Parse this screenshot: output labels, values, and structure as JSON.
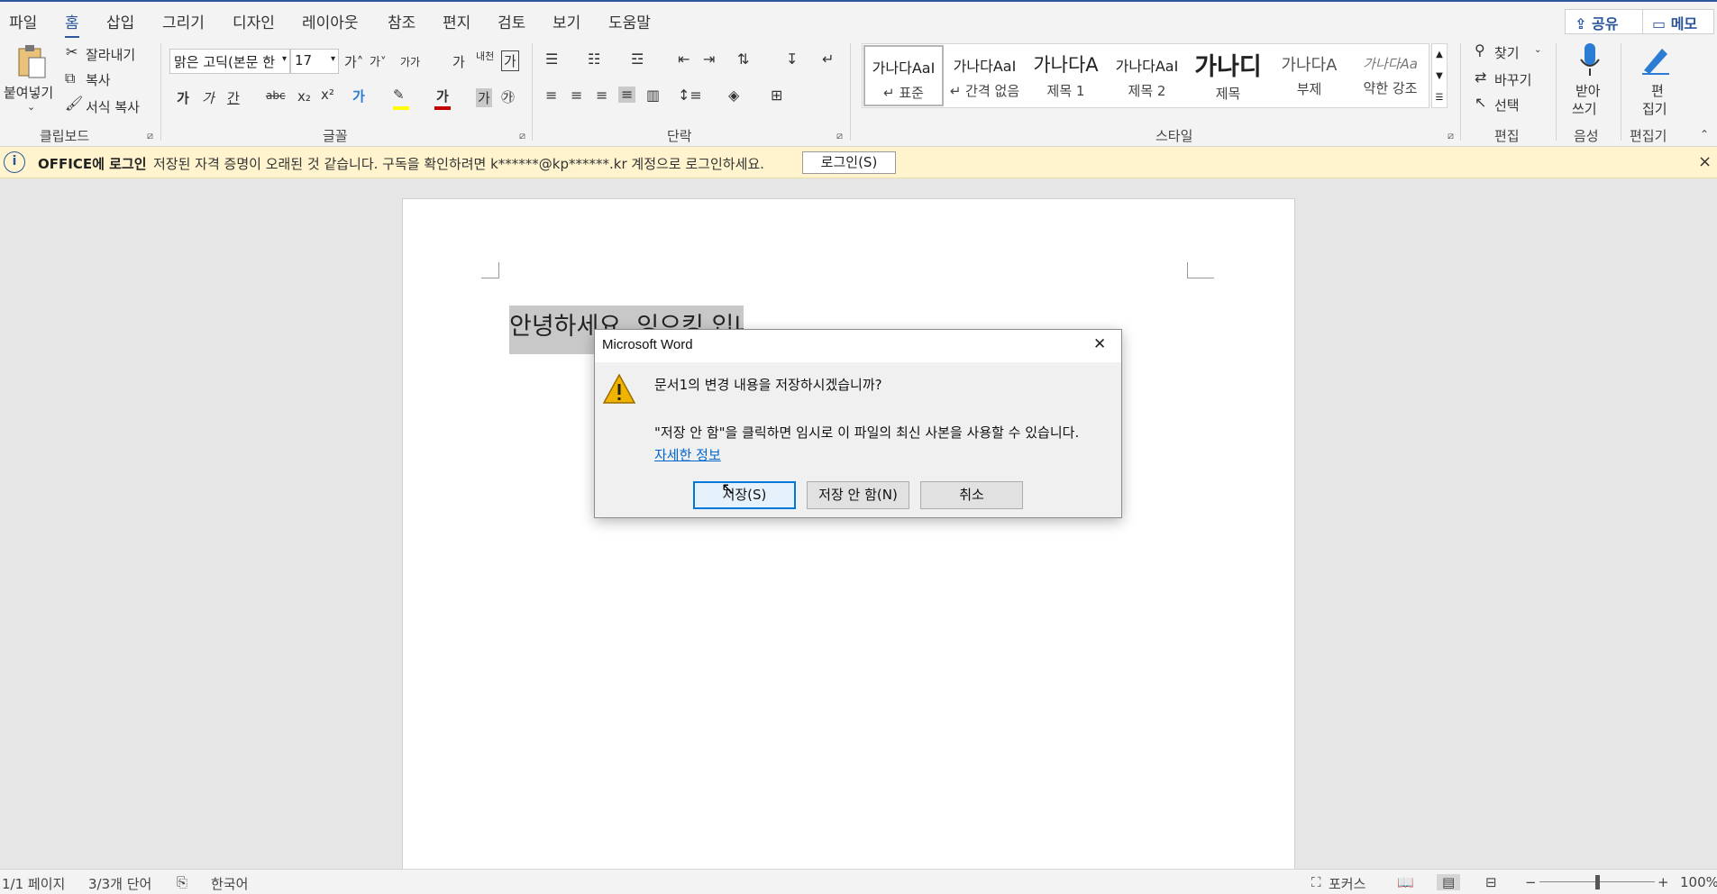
{
  "menubar": {
    "tabs": [
      "파일",
      "홈",
      "삽입",
      "그리기",
      "디자인",
      "레이아웃",
      "참조",
      "편지",
      "검토",
      "보기",
      "도움말"
    ],
    "active_tab": "홈",
    "share_label": "공유",
    "memo_label": "메모"
  },
  "ribbon": {
    "clipboard": {
      "paste_label": "붙여넣기",
      "cut_label": "잘라내기",
      "copy_label": "복사",
      "format_painter_label": "서식 복사",
      "group_label": "클립보드"
    },
    "font": {
      "font_name": "맑은 고딕(본문 한",
      "font_size": "17",
      "grow_label": "가˄",
      "shrink_label": "가˅",
      "case_label": "가가",
      "phonetic_label": "가",
      "hanja_label": "내천",
      "border_char_label": "가",
      "bold_label": "가",
      "italic_label": "가",
      "underline_label": "간",
      "strike_label": "abc",
      "sub_label": "x₂",
      "sup_label": "x²",
      "effect_label": "가",
      "highlight_label": "✎",
      "color_label": "가",
      "shade_label": "가",
      "enclose_label": "㉮",
      "group_label": "글꼴"
    },
    "paragraph": {
      "group_label": "단락"
    },
    "styles": {
      "items": [
        {
          "sample": "가나다AaI",
          "name": "↵ 표준"
        },
        {
          "sample": "가나다AaI",
          "name": "↵ 간격 없음"
        },
        {
          "sample": "가나다A",
          "name": "제목 1"
        },
        {
          "sample": "가나다AaI",
          "name": "제목 2"
        },
        {
          "sample": "가나디",
          "name": "제목"
        },
        {
          "sample": "가나다A",
          "name": "부제"
        },
        {
          "sample": "가나다Aa",
          "name": "약한 강조"
        }
      ],
      "group_label": "스타일"
    },
    "editing": {
      "find_label": "찾기",
      "replace_label": "바꾸기",
      "select_label": "선택",
      "group_label": "편집"
    },
    "voice": {
      "dictate_label_1": "받아",
      "dictate_label_2": "쓰기",
      "group_label": "음성"
    },
    "editor": {
      "editor_label_1": "편",
      "editor_label_2": "집기",
      "group_label": "편집기"
    }
  },
  "infobar": {
    "title": "OFFICE에 로그인",
    "message": "저장된 자격 증명이 오래된 것 같습니다. 구독을 확인하려면 k******@kp******.kr 계정으로 로그인하세요.",
    "login_label": "로그인(S)",
    "close_label": "×"
  },
  "document": {
    "text": "안녕하세요. 잉으킹 입니다."
  },
  "dialog": {
    "title": "Microsoft Word",
    "close_label": "✕",
    "question": "문서1의 변경 내용을 저장하시겠습니까?",
    "detail": "\"저장 안 함\"을 클릭하면 임시로 이 파일의 최신 사본을 사용할 수 있습니다.",
    "link": "자세한 정보",
    "save_label": "저장(S)",
    "dont_save_label": "저장 안 함(N)",
    "cancel_label": "취소"
  },
  "statusbar": {
    "page": "1/1 페이지",
    "words": "3/3개 단어",
    "language": "한국어",
    "focus_label": "포커스",
    "zoom_minus": "−",
    "zoom_plus": "+",
    "zoom_value": "100%",
    "zoom_fraction": 0.5
  },
  "colors": {
    "accent": "#2b579a",
    "infobar_bg": "#fff4ce",
    "font_color_bar": "#c00000",
    "highlight_bar": "#ffff00",
    "selection": "#c8c8c8",
    "link": "#0066cc",
    "warning": "#f0b400"
  }
}
